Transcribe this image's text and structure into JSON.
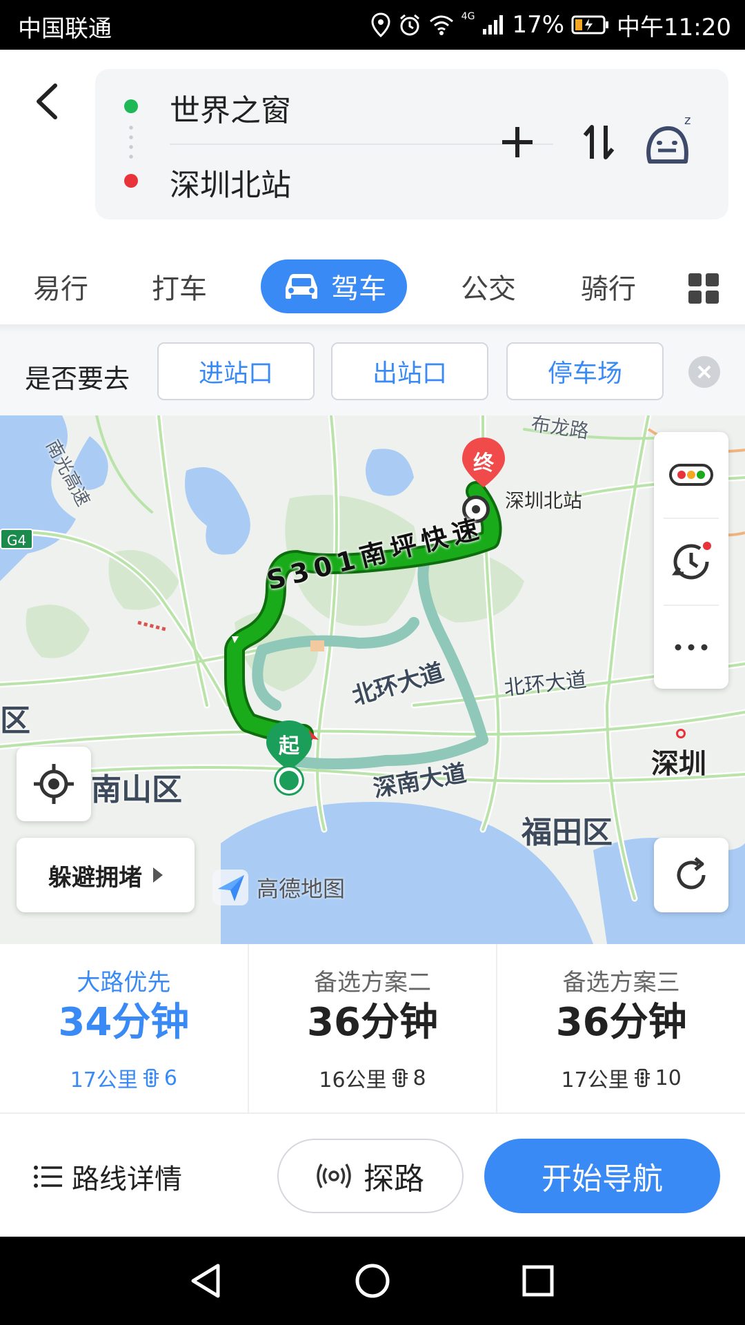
{
  "status_bar": {
    "carrier": "中国联通",
    "network": "4G",
    "battery": "17%",
    "time": "中午11:20"
  },
  "route_input": {
    "from": "世界之窗",
    "to": "深圳北站"
  },
  "tabs": [
    {
      "label": "易行",
      "active": false
    },
    {
      "label": "打车",
      "active": false
    },
    {
      "label": "驾车",
      "active": true
    },
    {
      "label": "公交",
      "active": false
    },
    {
      "label": "骑行",
      "active": false
    }
  ],
  "destination_prompt": {
    "label": "是否要去",
    "options": [
      "进站口",
      "出站口",
      "停车场"
    ]
  },
  "map": {
    "highway_shield": "G4",
    "labels": {
      "expressway_nw": "南光高速",
      "road_n": "布龙路",
      "station": "深圳北站",
      "expressway": "S301南坪快速",
      "beihuan_1": "北环大道",
      "beihuan_2": "北环大道",
      "shennan": "深南大道",
      "district_left": "区",
      "nanshan": "南山区",
      "futian": "福田区",
      "shenzhen": "深圳"
    },
    "start_marker": "起",
    "end_marker": "终",
    "avoid_button": "躲避拥堵",
    "logo": "高德地图"
  },
  "routes": [
    {
      "name": "大路优先",
      "time": "34分钟",
      "distance": "17公里",
      "lights": "6",
      "selected": true
    },
    {
      "name": "备选方案二",
      "time": "36分钟",
      "distance": "16公里",
      "lights": "8",
      "selected": false
    },
    {
      "name": "备选方案三",
      "time": "36分钟",
      "distance": "17公里",
      "lights": "10",
      "selected": false
    }
  ],
  "actions": {
    "details": "路线详情",
    "probe": "探路",
    "navigate": "开始导航"
  },
  "colors": {
    "accent": "#3a8af6",
    "route_green": "#1aab1a",
    "alt_route": "#8fc7b8"
  }
}
